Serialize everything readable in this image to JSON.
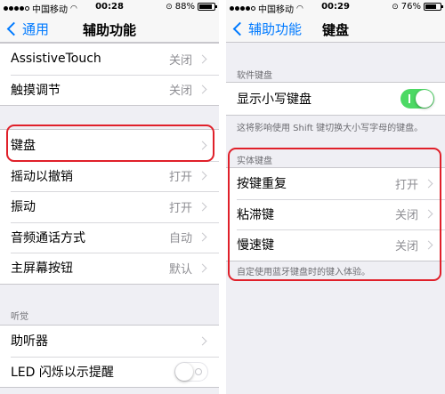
{
  "left": {
    "status": {
      "carrier": "中国移动",
      "time": "00:28",
      "battery": "88%",
      "battery_level": 0.88
    },
    "nav": {
      "back": "通用",
      "title": "辅助功能"
    },
    "group1": [
      {
        "label": "AssistiveTouch",
        "value": "关闭"
      },
      {
        "label": "触摸调节",
        "value": "关闭"
      }
    ],
    "group2": [
      {
        "label": "键盘",
        "value": ""
      },
      {
        "label": "摇动以撤销",
        "value": "打开"
      },
      {
        "label": "振动",
        "value": "打开"
      },
      {
        "label": "音频通话方式",
        "value": "自动"
      },
      {
        "label": "主屏幕按钮",
        "value": "默认"
      }
    ],
    "section_hearing": "听觉",
    "group3": [
      {
        "label": "助听器",
        "value": ""
      },
      {
        "label": "LED 闪烁以示提醒",
        "toggle": false
      }
    ]
  },
  "right": {
    "status": {
      "carrier": "中国移动",
      "time": "00:29",
      "battery": "76%",
      "battery_level": 0.76
    },
    "nav": {
      "back": "辅助功能",
      "title": "键盘"
    },
    "section_software": "软件键盘",
    "software_row": {
      "label": "显示小写键盘",
      "toggle": true
    },
    "software_footnote": "这将影响使用 Shift 键切换大小写字母的键盘。",
    "section_hardware": "实体键盘",
    "hardware_rows": [
      {
        "label": "按键重复",
        "value": "打开"
      },
      {
        "label": "粘滞键",
        "value": "关闭"
      },
      {
        "label": "慢速键",
        "value": "关闭"
      }
    ],
    "hardware_footnote": "自定使用蓝牙键盘时的键入体验。"
  },
  "colors": {
    "accent": "#007aff",
    "toggle_on": "#4cd964",
    "highlight": "#e0202a"
  }
}
